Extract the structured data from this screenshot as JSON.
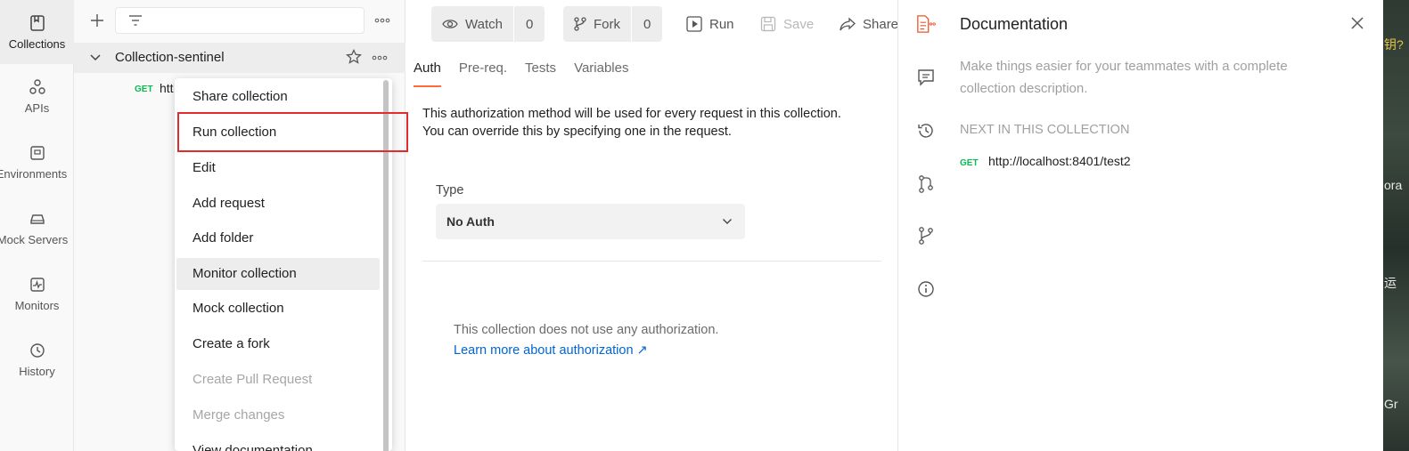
{
  "rail": {
    "items": [
      {
        "label": "Collections",
        "icon": "collections-icon"
      },
      {
        "label": "APIs",
        "icon": "apis-icon"
      },
      {
        "label": "Environments",
        "icon": "environments-icon"
      },
      {
        "label": "Mock Servers",
        "icon": "mock-servers-icon"
      },
      {
        "label": "Monitors",
        "icon": "monitors-icon"
      },
      {
        "label": "History",
        "icon": "history-icon"
      }
    ]
  },
  "sidebar": {
    "collection_name": "Collection-sentinel",
    "request": {
      "method": "GET",
      "url_fragment": "htt"
    }
  },
  "context_menu": {
    "items": [
      {
        "label": "Share collection",
        "state": "normal"
      },
      {
        "label": "Run collection",
        "state": "highlighted"
      },
      {
        "label": "Edit",
        "state": "normal"
      },
      {
        "label": "Add request",
        "state": "normal"
      },
      {
        "label": "Add folder",
        "state": "normal"
      },
      {
        "label": "Monitor collection",
        "state": "hover"
      },
      {
        "label": "Mock collection",
        "state": "normal"
      },
      {
        "label": "Create a fork",
        "state": "normal"
      },
      {
        "label": "Create Pull Request",
        "state": "disabled"
      },
      {
        "label": "Merge changes",
        "state": "disabled"
      },
      {
        "label": "View documentation",
        "state": "normal"
      }
    ]
  },
  "toolbar": {
    "watch_label": "Watch",
    "watch_count": "0",
    "fork_label": "Fork",
    "fork_count": "0",
    "run_label": "Run",
    "save_label": "Save",
    "share_label": "Share"
  },
  "tabs": [
    "Auth",
    "Pre-req.",
    "Tests",
    "Variables"
  ],
  "auth": {
    "description": "This authorization method will be used for every request in this collection. You can override this by specifying one in the request.",
    "type_label": "Type",
    "type_value": "No Auth",
    "no_auth_text": "This collection does not use any authorization.",
    "learn_more": "Learn more about authorization ↗"
  },
  "doc_panel": {
    "title": "Documentation",
    "description": "Make things easier for your teammates with a complete collection description.",
    "next_heading": "NEXT IN THIS COLLECTION",
    "next_request": {
      "method": "GET",
      "url": "http://localhost:8401/test2"
    }
  },
  "edge_text": {
    "top": "钥?",
    "mid": "ora",
    "lower": "运",
    "bottom": "Gr"
  },
  "colors": {
    "accent": "#ff6c37",
    "highlight": "#e02c2c",
    "link": "#0265d2",
    "get": "#0cbb52"
  }
}
